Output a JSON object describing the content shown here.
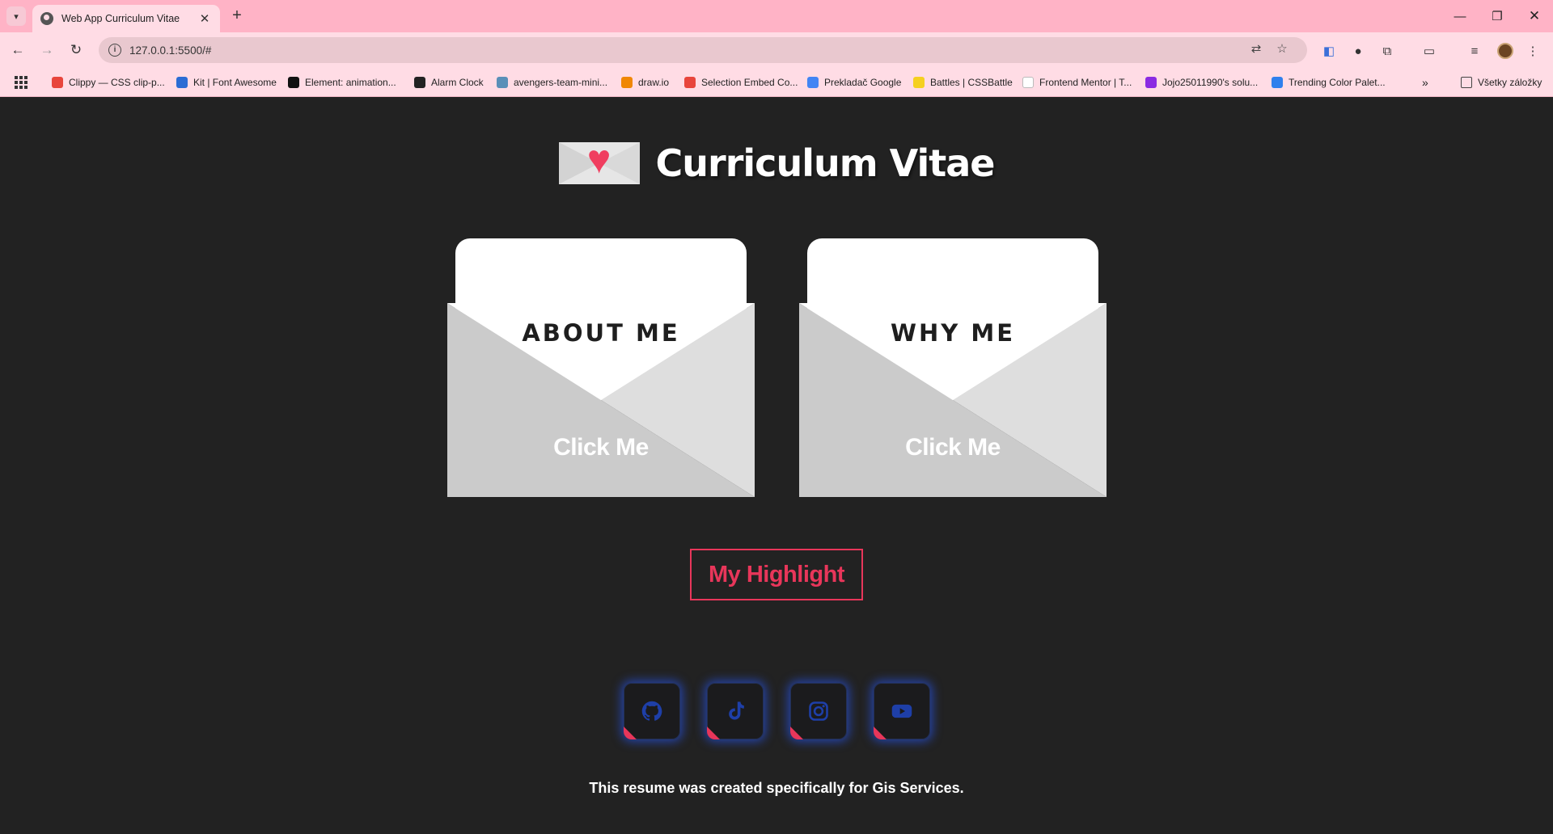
{
  "browser": {
    "tab_title": "Web App Curriculum Vitae",
    "tab_close": "✕",
    "new_tab": "+",
    "url": "127.0.0.1:5500/#",
    "bookmarks": [
      {
        "label": "Clippy — CSS clip-p...",
        "color": "#e8453c"
      },
      {
        "label": "Kit | Font Awesome",
        "color": "#2b6cd4"
      },
      {
        "label": "Element: animation...",
        "color": "#111111"
      },
      {
        "label": "Alarm Clock",
        "color": "#222222"
      },
      {
        "label": "avengers-team-mini...",
        "color": "#5a8fb8"
      },
      {
        "label": "draw.io",
        "color": "#f08705"
      },
      {
        "label": "Selection Embed Co...",
        "color": "#e8453c"
      },
      {
        "label": "Prekladač Google",
        "color": "#4285f4"
      },
      {
        "label": "Battles | CSSBattle",
        "color": "#f5d020"
      },
      {
        "label": "Frontend Mentor | T...",
        "color": "#ffffff"
      },
      {
        "label": "Jojo25011990's solu...",
        "color": "#8a2be2"
      },
      {
        "label": "Trending Color Palet...",
        "color": "#2f80ed"
      }
    ],
    "bookmarks_more": "»",
    "all_bookmarks": "Všetky záložky"
  },
  "header": {
    "title": "Curriculum Vitae"
  },
  "cards": [
    {
      "label": "ABOUT ME",
      "action": "Click Me"
    },
    {
      "label": "WHY ME",
      "action": "Click Me"
    }
  ],
  "highlight_button": "My Highlight",
  "socials": [
    {
      "name": "github-icon"
    },
    {
      "name": "tiktok-icon"
    },
    {
      "name": "instagram-icon"
    },
    {
      "name": "youtube-icon"
    }
  ],
  "footer": "This resume was created specifically for Gis Services.",
  "colors": {
    "background": "#222222",
    "accent": "#e8365a",
    "chrome": "#ffb3c6",
    "glow": "#285aff",
    "icon": "#1e3fa8"
  }
}
